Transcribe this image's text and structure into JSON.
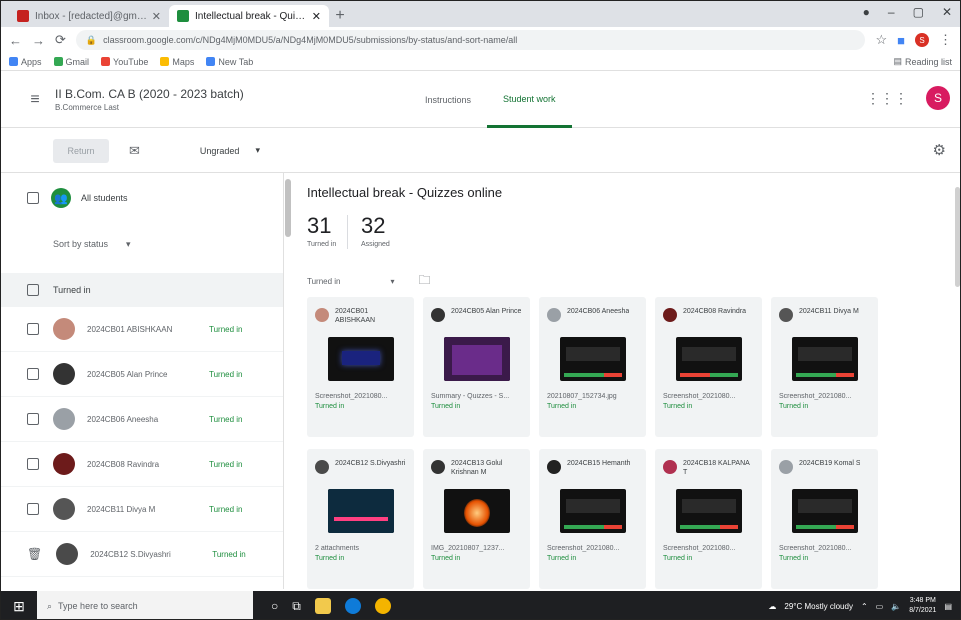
{
  "browser": {
    "tabs": [
      {
        "title": "Inbox - [redacted]@gmail.com",
        "active": false,
        "color": "#c5221f"
      },
      {
        "title": "Intellectual break - Quizzes onl",
        "active": true,
        "color": "#1e8e3e"
      }
    ],
    "url": "classroom.google.com/c/NDg4MjM0MDU5/a/NDg4MjM0MDU5/submissions/by-status/and-sort-name/all",
    "bookmarks": [
      {
        "label": "Apps",
        "color": "#4285f4"
      },
      {
        "label": "Gmail",
        "color": "#34a853"
      },
      {
        "label": "YouTube",
        "color": "#ea4335"
      },
      {
        "label": "Maps",
        "color": "#fbbc04"
      },
      {
        "label": "New Tab",
        "color": "#4285f4"
      }
    ],
    "reading_list": "Reading list"
  },
  "header": {
    "class_name": "II B.Com. CA B (2020 - 2023 batch)",
    "class_sub": "B.Commerce Last",
    "tabs": [
      {
        "label": "Instructions",
        "active": false
      },
      {
        "label": "Student work",
        "active": true
      }
    ],
    "avatar_letter": "S"
  },
  "actionbar": {
    "return_label": "Return",
    "grade_filter": "Ungraded"
  },
  "left": {
    "all_students": "All students",
    "sort_by": "Sort by status",
    "section": "Turned in",
    "students": [
      {
        "name": "2024CB01 ABISHKAAN",
        "status": "Turned in",
        "color": "#c48a7a"
      },
      {
        "name": "2024CB05 Alan Prince",
        "status": "Turned in",
        "color": "#333"
      },
      {
        "name": "2024CB06 Aneesha",
        "status": "Turned in",
        "color": "#9aa0a6"
      },
      {
        "name": "2024CB08 Ravindra",
        "status": "Turned in",
        "color": "#6d1b1b"
      },
      {
        "name": "2024CB11 Divya M",
        "status": "Turned in",
        "color": "#555"
      },
      {
        "name": "2024CB12 S.Divyashri",
        "status": "Turned in",
        "color": "#4a4a4a"
      }
    ]
  },
  "assignment": {
    "title": "Intellectual break - Quizzes online",
    "turned_in_count": "31",
    "turned_in_label": "Turned in",
    "assigned_count": "32",
    "assigned_label": "Assigned",
    "filter": "Turned in",
    "cards": [
      {
        "name": "2024CB01 ABISHKAAN",
        "file": "Screenshot_2021080...",
        "status": "Turned in",
        "color": "#c48a7a",
        "thumb": "blue"
      },
      {
        "name": "2024CB05 Alan Prince",
        "file": "Summary - Quizzes - S...",
        "status": "Turned in",
        "color": "#333",
        "thumb": "purple"
      },
      {
        "name": "2024CB06 Aneesha",
        "file": "20210807_152734.jpg",
        "status": "Turned in",
        "color": "#9aa0a6",
        "thumb": "green"
      },
      {
        "name": "2024CB08 Ravindra",
        "file": "Screenshot_2021080...",
        "status": "Turned in",
        "color": "#6d1b1b",
        "thumb": "red"
      },
      {
        "name": "2024CB11 Divya M",
        "file": "Screenshot_2021080...",
        "status": "Turned in",
        "color": "#555",
        "thumb": "green"
      },
      {
        "name": "2024CB12 S.Divyashri",
        "file": "2 attachments",
        "status": "Turned in",
        "color": "#4a4a4a",
        "thumb": "pink"
      },
      {
        "name": "2024CB13 Golul Krishnan M",
        "file": "IMG_20210807_1237...",
        "status": "Turned in",
        "color": "#333",
        "thumb": "fire"
      },
      {
        "name": "2024CB15 Hemanth",
        "file": "Screenshot_2021080...",
        "status": "Turned in",
        "color": "#222",
        "thumb": "green"
      },
      {
        "name": "2024CB18 KALPANA T",
        "file": "Screenshot_2021080...",
        "status": "Turned in",
        "color": "#b03050",
        "thumb": "green"
      },
      {
        "name": "2024CB19 Komal S",
        "file": "Screenshot_2021080...",
        "status": "Turned in",
        "color": "#9aa0a6",
        "thumb": "green"
      }
    ]
  },
  "taskbar": {
    "search_placeholder": "Type here to search",
    "weather": "29°C  Mostly cloudy",
    "time": "3:48 PM",
    "date": "8/7/2021"
  },
  "colors": {
    "accent_green": "#1e8e3e",
    "classroom_green": "#137333",
    "avatar_pink": "#d81b60"
  }
}
